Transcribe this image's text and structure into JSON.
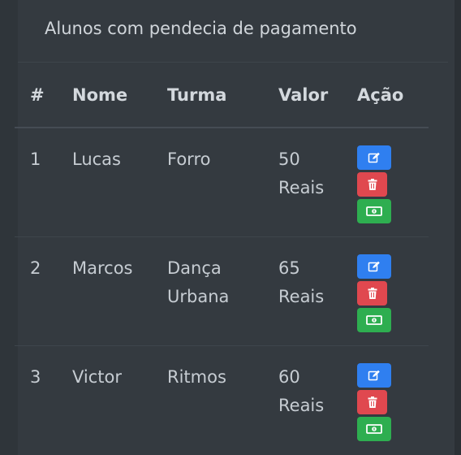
{
  "card": {
    "title": "Alunos com pendecia de pagamento"
  },
  "table": {
    "headers": {
      "idx": "#",
      "name": "Nome",
      "turma": "Turma",
      "valor": "Valor",
      "acao": "Ação"
    },
    "rows": [
      {
        "idx": "1",
        "name": "Lucas",
        "turma": "Forro",
        "turma2": "",
        "valor_num": "50",
        "valor_unit": "Reais"
      },
      {
        "idx": "2",
        "name": "Marcos",
        "turma": "Dança",
        "turma2": "Urbana",
        "valor_num": "65",
        "valor_unit": "Reais"
      },
      {
        "idx": "3",
        "name": "Victor",
        "turma": "Ritmos",
        "turma2": "",
        "valor_num": "60",
        "valor_unit": "Reais"
      }
    ]
  },
  "icons": {
    "edit": "edit-icon",
    "delete": "trash-icon",
    "pay": "money-bill-icon"
  },
  "colors": {
    "edit": "#2f7ff0",
    "delete": "#e0484f",
    "pay": "#2eae50"
  }
}
